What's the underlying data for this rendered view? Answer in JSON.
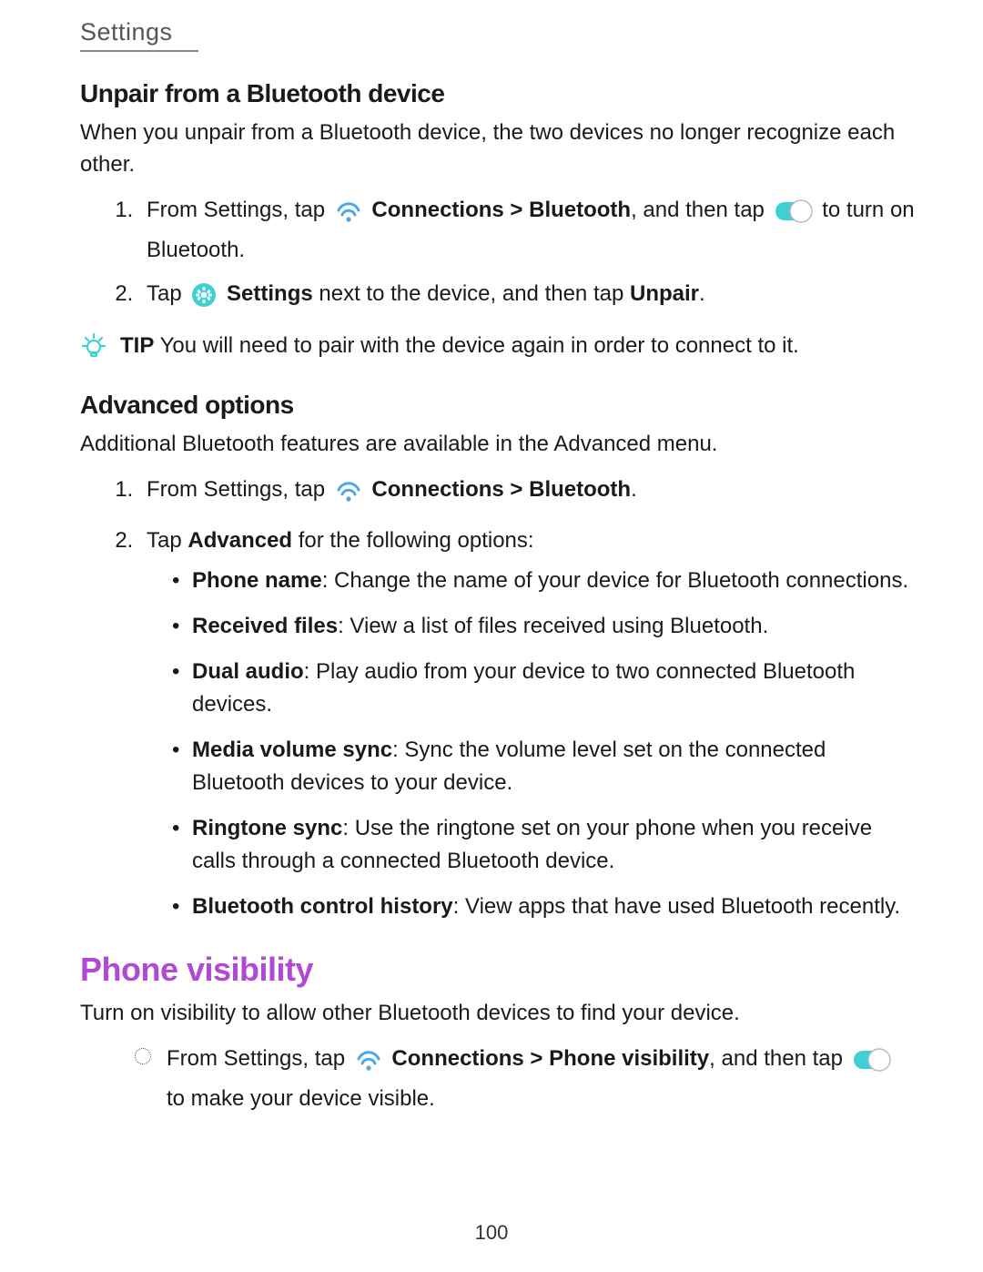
{
  "header": "Settings",
  "colors": {
    "accent_purple": "#b049d6",
    "accent_teal": "#3fd0d4",
    "wifi_blue": "#4aa8e8"
  },
  "sec1": {
    "title": "Unpair from a Bluetooth device",
    "intro": "When you unpair from a Bluetooth device, the two devices no longer recognize each other.",
    "step1_a": "From Settings, tap ",
    "step1_b": " Connections > Bluetooth",
    "step1_c": ", and then tap ",
    "step1_d": " to turn on Bluetooth.",
    "step2_a": "Tap ",
    "step2_b": " Settings",
    "step2_c": " next to the device, and then tap ",
    "step2_d": "Unpair",
    "step2_e": ".",
    "tip_label": "TIP",
    "tip_text": "  You will need to pair with the device again in order to connect to it."
  },
  "sec2": {
    "title": "Advanced options",
    "intro": "Additional Bluetooth features are available in the Advanced menu.",
    "step1_a": "From Settings, tap ",
    "step1_b": " Connections > Bluetooth",
    "step1_c": ".",
    "step2_a": "Tap ",
    "step2_b": "Advanced",
    "step2_c": " for the following options:",
    "opts": [
      {
        "t": "Phone name",
        "d": ": Change the name of your device for Bluetooth connections."
      },
      {
        "t": "Received files",
        "d": ": View a list of files received using Bluetooth."
      },
      {
        "t": "Dual audio",
        "d": ": Play audio from your device to two connected Bluetooth devices."
      },
      {
        "t": "Media volume sync",
        "d": ": Sync the volume level set on the connected Bluetooth devices to your device."
      },
      {
        "t": "Ringtone sync",
        "d": ": Use the ringtone set on your phone when you receive calls through a connected Bluetooth device."
      },
      {
        "t": "Bluetooth control history",
        "d": ": View apps that have used Bluetooth recently."
      }
    ]
  },
  "sec3": {
    "title": "Phone visibility",
    "intro": "Turn on visibility to allow other Bluetooth devices to find your device.",
    "step_a": "From Settings, tap ",
    "step_b": " Connections > Phone visibility",
    "step_c": ", and then tap ",
    "step_d": " to make your device visible."
  },
  "page_number": "100"
}
